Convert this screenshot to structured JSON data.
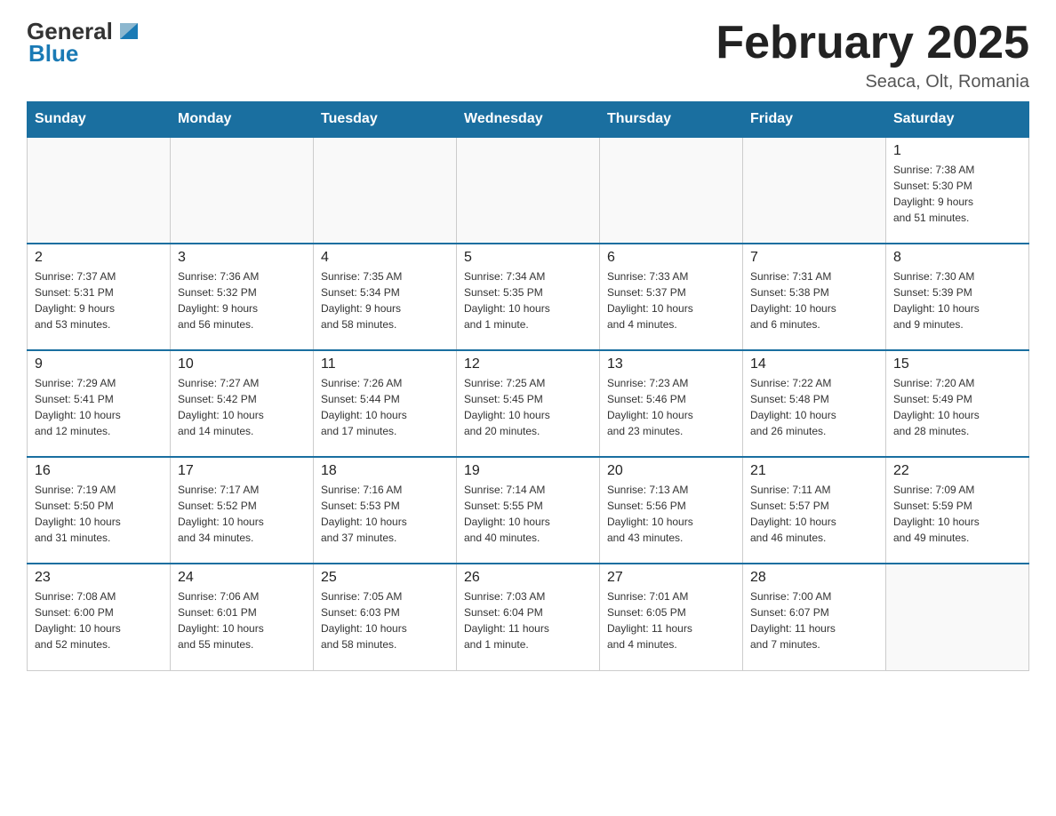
{
  "header": {
    "logo_general": "General",
    "logo_blue": "Blue",
    "title": "February 2025",
    "location": "Seaca, Olt, Romania"
  },
  "weekdays": [
    "Sunday",
    "Monday",
    "Tuesday",
    "Wednesday",
    "Thursday",
    "Friday",
    "Saturday"
  ],
  "weeks": [
    [
      {
        "day": "",
        "info": ""
      },
      {
        "day": "",
        "info": ""
      },
      {
        "day": "",
        "info": ""
      },
      {
        "day": "",
        "info": ""
      },
      {
        "day": "",
        "info": ""
      },
      {
        "day": "",
        "info": ""
      },
      {
        "day": "1",
        "info": "Sunrise: 7:38 AM\nSunset: 5:30 PM\nDaylight: 9 hours\nand 51 minutes."
      }
    ],
    [
      {
        "day": "2",
        "info": "Sunrise: 7:37 AM\nSunset: 5:31 PM\nDaylight: 9 hours\nand 53 minutes."
      },
      {
        "day": "3",
        "info": "Sunrise: 7:36 AM\nSunset: 5:32 PM\nDaylight: 9 hours\nand 56 minutes."
      },
      {
        "day": "4",
        "info": "Sunrise: 7:35 AM\nSunset: 5:34 PM\nDaylight: 9 hours\nand 58 minutes."
      },
      {
        "day": "5",
        "info": "Sunrise: 7:34 AM\nSunset: 5:35 PM\nDaylight: 10 hours\nand 1 minute."
      },
      {
        "day": "6",
        "info": "Sunrise: 7:33 AM\nSunset: 5:37 PM\nDaylight: 10 hours\nand 4 minutes."
      },
      {
        "day": "7",
        "info": "Sunrise: 7:31 AM\nSunset: 5:38 PM\nDaylight: 10 hours\nand 6 minutes."
      },
      {
        "day": "8",
        "info": "Sunrise: 7:30 AM\nSunset: 5:39 PM\nDaylight: 10 hours\nand 9 minutes."
      }
    ],
    [
      {
        "day": "9",
        "info": "Sunrise: 7:29 AM\nSunset: 5:41 PM\nDaylight: 10 hours\nand 12 minutes."
      },
      {
        "day": "10",
        "info": "Sunrise: 7:27 AM\nSunset: 5:42 PM\nDaylight: 10 hours\nand 14 minutes."
      },
      {
        "day": "11",
        "info": "Sunrise: 7:26 AM\nSunset: 5:44 PM\nDaylight: 10 hours\nand 17 minutes."
      },
      {
        "day": "12",
        "info": "Sunrise: 7:25 AM\nSunset: 5:45 PM\nDaylight: 10 hours\nand 20 minutes."
      },
      {
        "day": "13",
        "info": "Sunrise: 7:23 AM\nSunset: 5:46 PM\nDaylight: 10 hours\nand 23 minutes."
      },
      {
        "day": "14",
        "info": "Sunrise: 7:22 AM\nSunset: 5:48 PM\nDaylight: 10 hours\nand 26 minutes."
      },
      {
        "day": "15",
        "info": "Sunrise: 7:20 AM\nSunset: 5:49 PM\nDaylight: 10 hours\nand 28 minutes."
      }
    ],
    [
      {
        "day": "16",
        "info": "Sunrise: 7:19 AM\nSunset: 5:50 PM\nDaylight: 10 hours\nand 31 minutes."
      },
      {
        "day": "17",
        "info": "Sunrise: 7:17 AM\nSunset: 5:52 PM\nDaylight: 10 hours\nand 34 minutes."
      },
      {
        "day": "18",
        "info": "Sunrise: 7:16 AM\nSunset: 5:53 PM\nDaylight: 10 hours\nand 37 minutes."
      },
      {
        "day": "19",
        "info": "Sunrise: 7:14 AM\nSunset: 5:55 PM\nDaylight: 10 hours\nand 40 minutes."
      },
      {
        "day": "20",
        "info": "Sunrise: 7:13 AM\nSunset: 5:56 PM\nDaylight: 10 hours\nand 43 minutes."
      },
      {
        "day": "21",
        "info": "Sunrise: 7:11 AM\nSunset: 5:57 PM\nDaylight: 10 hours\nand 46 minutes."
      },
      {
        "day": "22",
        "info": "Sunrise: 7:09 AM\nSunset: 5:59 PM\nDaylight: 10 hours\nand 49 minutes."
      }
    ],
    [
      {
        "day": "23",
        "info": "Sunrise: 7:08 AM\nSunset: 6:00 PM\nDaylight: 10 hours\nand 52 minutes."
      },
      {
        "day": "24",
        "info": "Sunrise: 7:06 AM\nSunset: 6:01 PM\nDaylight: 10 hours\nand 55 minutes."
      },
      {
        "day": "25",
        "info": "Sunrise: 7:05 AM\nSunset: 6:03 PM\nDaylight: 10 hours\nand 58 minutes."
      },
      {
        "day": "26",
        "info": "Sunrise: 7:03 AM\nSunset: 6:04 PM\nDaylight: 11 hours\nand 1 minute."
      },
      {
        "day": "27",
        "info": "Sunrise: 7:01 AM\nSunset: 6:05 PM\nDaylight: 11 hours\nand 4 minutes."
      },
      {
        "day": "28",
        "info": "Sunrise: 7:00 AM\nSunset: 6:07 PM\nDaylight: 11 hours\nand 7 minutes."
      },
      {
        "day": "",
        "info": ""
      }
    ]
  ]
}
